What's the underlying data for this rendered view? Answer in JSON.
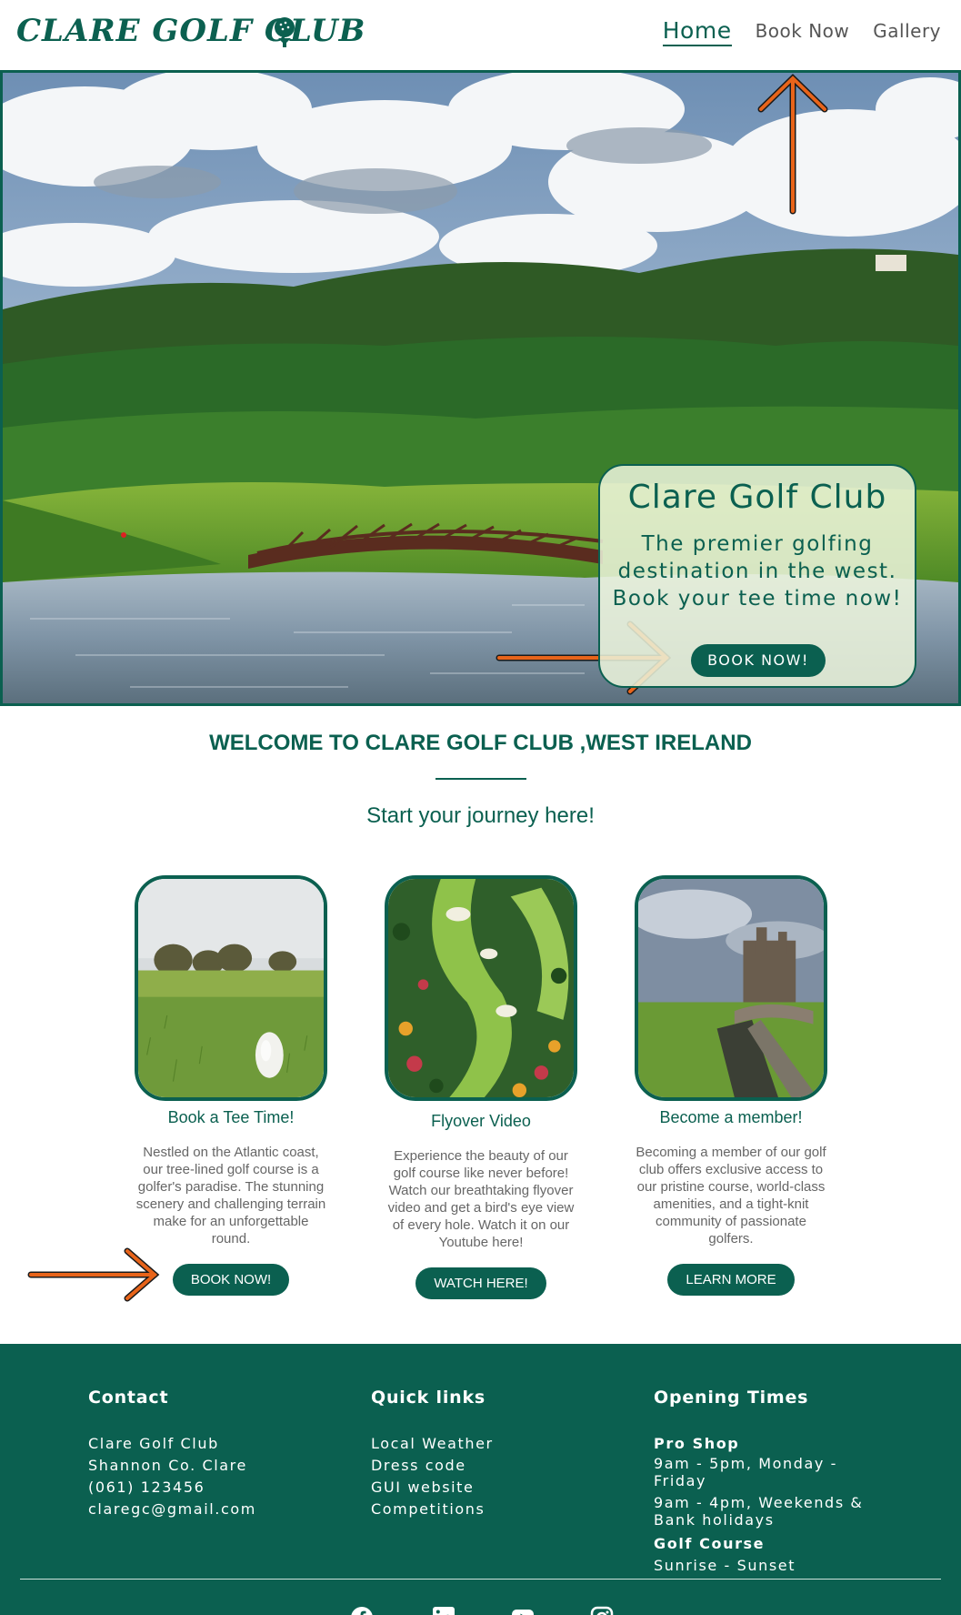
{
  "header": {
    "logo_text": "CLARE GOLF CLUB",
    "logo_icon": "golf-ball-on-tee-icon",
    "nav": [
      {
        "label": "Home",
        "active": true
      },
      {
        "label": "Book Now",
        "active": false
      },
      {
        "label": "Gallery",
        "active": false
      }
    ]
  },
  "hero": {
    "title": "Clare Golf Club",
    "tagline": "The premier golfing destination in the west. Book your tee time now!",
    "button": "BOOK NOW!"
  },
  "welcome": {
    "title": "WELCOME TO CLARE GOLF CLUB ,WEST IRELAND",
    "subtitle": "Start your journey here!"
  },
  "cards": [
    {
      "title": "Book a Tee Time!",
      "text": "Nestled on the Atlantic coast, our tree-lined golf course is a golfer's paradise. The stunning scenery and challenging terrain make for an unforgettable round.",
      "button": "BOOK NOW!"
    },
    {
      "title": "Flyover Video",
      "text": "Experience the beauty of our golf course like never before! Watch our breathtaking flyover video and get a bird's eye view of every hole. Watch it on our Youtube here!",
      "button": "WATCH HERE!"
    },
    {
      "title": "Become a member!",
      "text": "Becoming a member of our golf club offers exclusive access to our pristine course, world-class amenities, and a tight-knit community of passionate golfers.",
      "button": "LEARN MORE"
    }
  ],
  "footer": {
    "contact": {
      "heading": "Contact",
      "lines": [
        "Clare Golf Club",
        "Shannon Co. Clare",
        "(061) 123456",
        "claregc@gmail.com"
      ]
    },
    "quick_links": {
      "heading": "Quick links",
      "links": [
        "Local Weather",
        "Dress code",
        "GUI website",
        "Competitions"
      ]
    },
    "opening": {
      "heading": "Opening Times",
      "pro_shop": "Pro Shop",
      "pro_shop_weekday": "9am - 5pm, Monday - Friday",
      "pro_shop_weekend": "9am - 4pm, Weekends & Bank holidays",
      "course": "Golf Course",
      "course_hours": "Sunrise - Sunset"
    },
    "social_icons": [
      "facebook-icon",
      "linkedin-icon",
      "youtube-icon",
      "instagram-icon"
    ]
  },
  "colors": {
    "brand_green": "#0b6050",
    "annotation_arrow": "#e8641a",
    "card_overlay": "#ecf5dc"
  }
}
